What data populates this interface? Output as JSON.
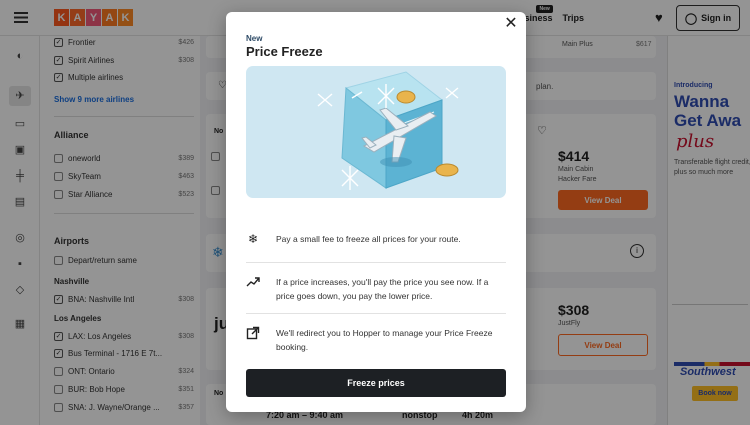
{
  "header": {
    "logo_letters": [
      "K",
      "A",
      "Y",
      "A",
      "K"
    ],
    "logo_colors": [
      "#ff5a1f",
      "#ff6a2a",
      "#f35a7a",
      "#ff7a21",
      "#ff8a25"
    ],
    "business_label": "Business",
    "business_badge": "New",
    "trips_label": "Trips",
    "signin_label": "Sign in"
  },
  "filters": {
    "airlines": [
      {
        "label": "Frontier",
        "price": "$426",
        "checked": true
      },
      {
        "label": "Spirit Airlines",
        "price": "$308",
        "checked": true
      },
      {
        "label": "Multiple airlines",
        "price": "",
        "checked": true
      }
    ],
    "show_more": "Show 9 more airlines",
    "alliance_title": "Alliance",
    "alliances": [
      {
        "label": "oneworld",
        "price": "$389"
      },
      {
        "label": "SkyTeam",
        "price": "$463"
      },
      {
        "label": "Star Alliance",
        "price": "$523"
      }
    ],
    "airports_title": "Airports",
    "same_airport": "Depart/return same",
    "nashville_title": "Nashville",
    "nashville": [
      {
        "label": "BNA: Nashville Intl",
        "price": "$308"
      }
    ],
    "la_title": "Los Angeles",
    "la": [
      {
        "label": "LAX: Los Angeles",
        "price": "$308"
      },
      {
        "label": "Bus Terminal - 1716 E 7t...",
        "price": ""
      },
      {
        "label": "ONT: Ontario",
        "price": "$324"
      },
      {
        "label": "BUR: Bob Hope",
        "price": "$351"
      },
      {
        "label": "SNA: J. Wayne/Orange ...",
        "price": "$357"
      }
    ]
  },
  "results": {
    "main_plus": "Main Plus",
    "main_plus_price": "$617",
    "plan_snippet": "plan.",
    "card1": {
      "price": "$414",
      "cabin": "Main Cabin",
      "fare": "Hacker Fare",
      "cta": "View Deal"
    },
    "card2": {
      "price": "$308",
      "cabin": "JustFly",
      "cta": "View Deal",
      "airline_fragment": "ju"
    },
    "bottom_row": {
      "times": "7:20 am – 9:40 am",
      "stops": "nonstop",
      "duration": "4h 20m"
    }
  },
  "ad": {
    "intro": "Introducing",
    "headline1": "Wanna",
    "headline2": "Get Awa",
    "script": "plus",
    "body": "Transferable flight credit, plus so much more",
    "brand": "Southwest",
    "book": "Book now"
  },
  "modal": {
    "eyebrow": "New",
    "title": "Price Freeze",
    "features": [
      {
        "icon": "snowflake-icon",
        "text": "Pay a small fee to freeze all prices for your route."
      },
      {
        "icon": "trend-up-icon",
        "text": "If a price increases, you'll pay the price you see now. If a price goes down, you pay the lower price."
      },
      {
        "icon": "external-link-icon",
        "text": "We'll redirect you to Hopper to manage your Price Freeze booking."
      }
    ],
    "cta": "Freeze prices"
  }
}
